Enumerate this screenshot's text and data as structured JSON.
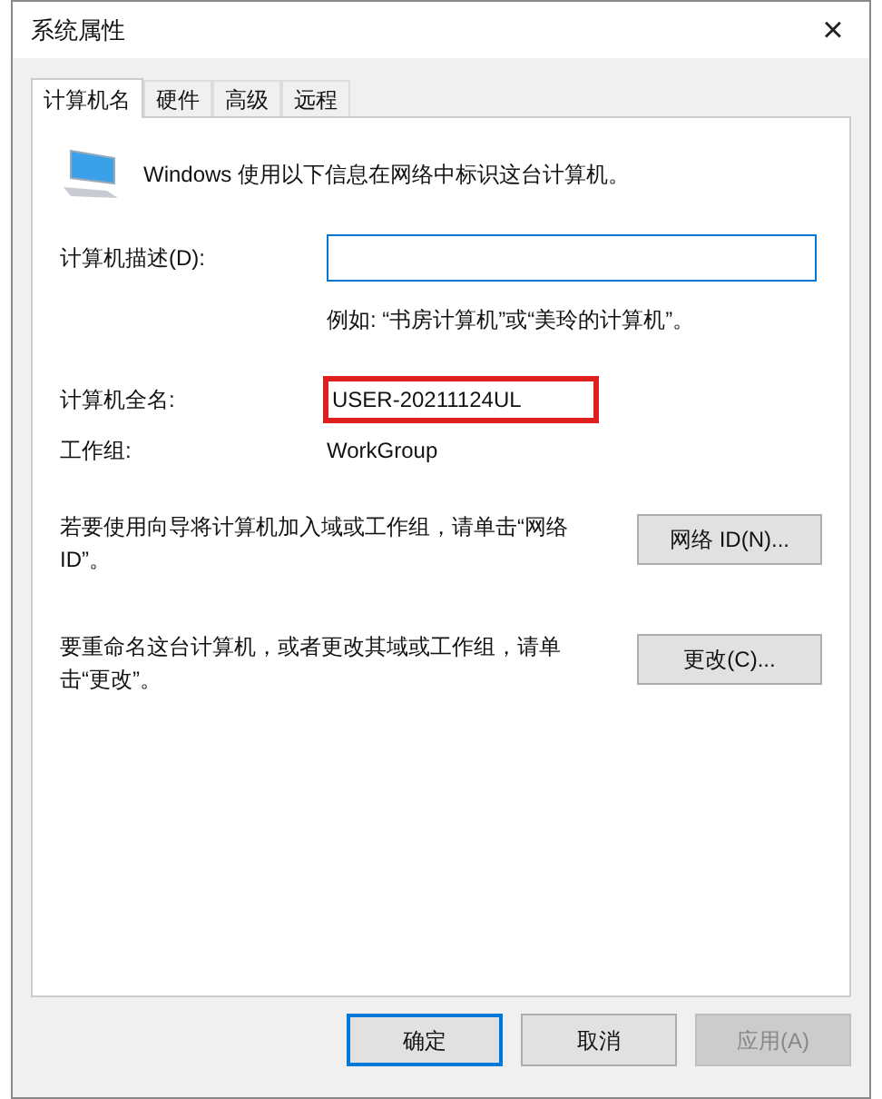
{
  "window": {
    "title": "系统属性",
    "close": "×"
  },
  "tabs": [
    {
      "label": "计算机名",
      "selected": true
    },
    {
      "label": "硬件",
      "selected": false
    },
    {
      "label": "高级",
      "selected": false
    },
    {
      "label": "远程",
      "selected": false
    }
  ],
  "intro": "Windows 使用以下信息在网络中标识这台计算机。",
  "description": {
    "label": "计算机描述(D):",
    "focused": true,
    "example": "例如: “书房计算机”或“美玲的计算机”。"
  },
  "full_name": {
    "label": "计算机全名:",
    "value": "USER-20211124UL",
    "highlighted": true
  },
  "workgroup": {
    "label": "工作组:",
    "value": "WorkGroup"
  },
  "actions": [
    {
      "text": "若要使用向导将计算机加入域或工作组，请单击“网络 ID”。",
      "button": "网络 ID(N)..."
    },
    {
      "text": "要重命名这台计算机，或者更改其域或工作组，请单击“更改”。",
      "button": "更改(C)..."
    }
  ],
  "buttons": [
    {
      "label": "确定",
      "default": true,
      "disabled": false
    },
    {
      "label": "取消",
      "default": false,
      "disabled": false
    },
    {
      "label": "应用(A)",
      "default": false,
      "disabled": true
    }
  ]
}
